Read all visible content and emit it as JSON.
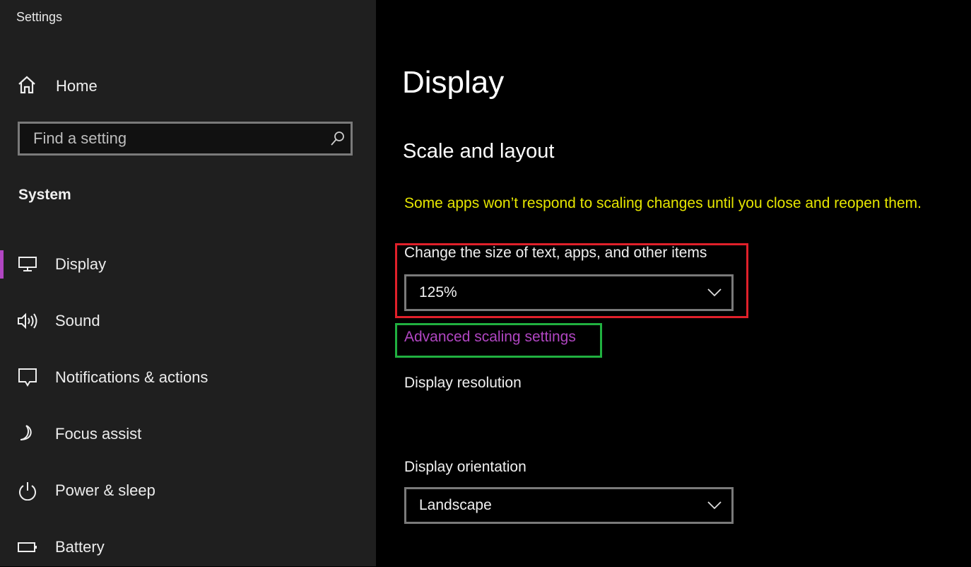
{
  "app": {
    "title": "Settings"
  },
  "sidebar": {
    "home_label": "Home",
    "search": {
      "placeholder": "Find a setting",
      "value": ""
    },
    "section": "System",
    "items": [
      {
        "label": "Display",
        "icon": "monitor-icon",
        "selected": true
      },
      {
        "label": "Sound",
        "icon": "speaker-icon",
        "selected": false
      },
      {
        "label": "Notifications & actions",
        "icon": "notification-icon",
        "selected": false
      },
      {
        "label": "Focus assist",
        "icon": "moon-icon",
        "selected": false
      },
      {
        "label": "Power & sleep",
        "icon": "power-icon",
        "selected": false
      },
      {
        "label": "Battery",
        "icon": "battery-icon",
        "selected": false
      }
    ],
    "accent_color": "#b146c2"
  },
  "main": {
    "title": "Display",
    "section_title": "Scale and layout",
    "warning": "Some apps won’t respond to scaling changes until you close and reopen them.",
    "scale": {
      "label": "Change the size of text, apps, and other items",
      "value": "125%"
    },
    "advanced_link": "Advanced scaling settings",
    "resolution_label": "Display resolution",
    "orientation": {
      "label": "Display orientation",
      "value": "Landscape"
    },
    "colors": {
      "warning": "#e6e600",
      "link": "#b146c2",
      "highlight_red": "#e0202a",
      "highlight_green": "#20b040"
    }
  }
}
